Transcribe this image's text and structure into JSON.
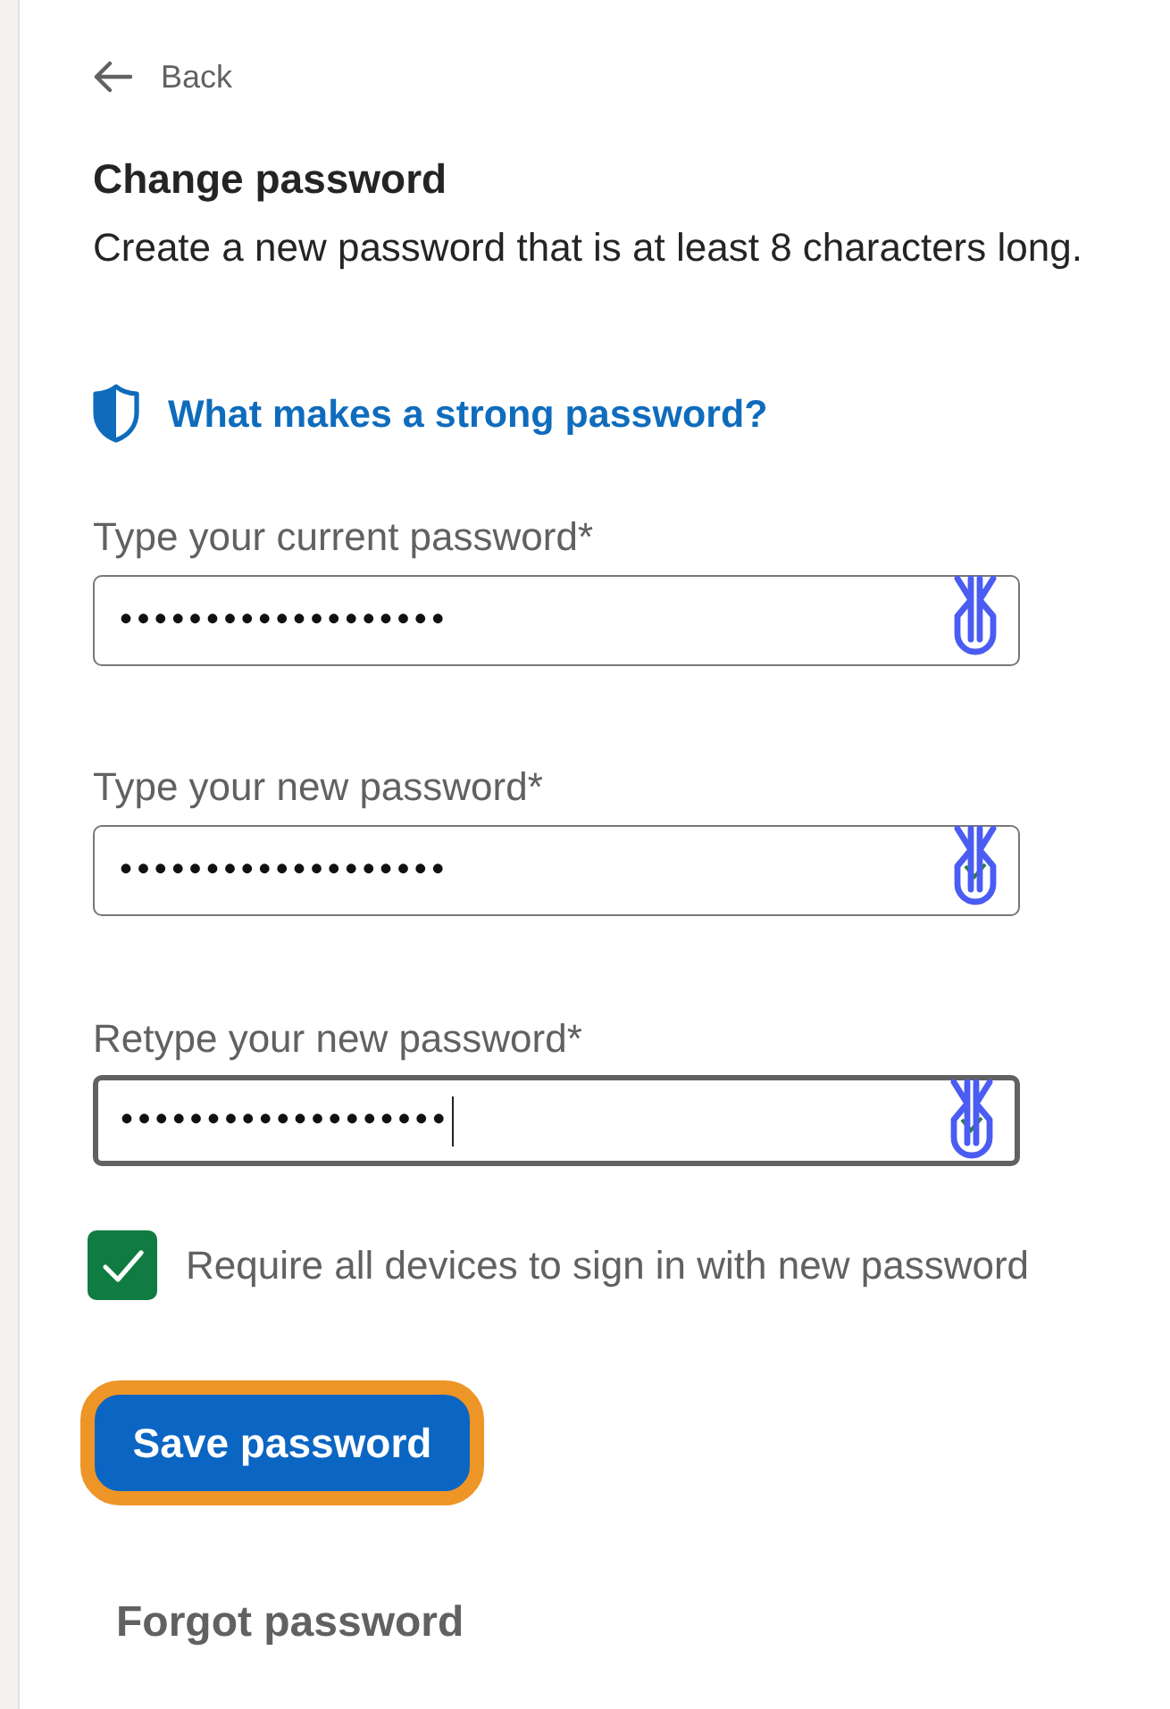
{
  "back": {
    "label": "Back"
  },
  "heading": "Change password",
  "description": "Create a new password that is at least 8 characters long.",
  "help_link": {
    "label": "What makes a strong password?"
  },
  "fields": [
    {
      "label": "Type your current password*",
      "value": "•••••••••••••••••••",
      "focused": false,
      "valid": false
    },
    {
      "label": "Type your new password*",
      "value": "•••••••••••••••••••",
      "focused": false,
      "valid": true
    },
    {
      "label": "Retype your new password*",
      "value": "•••••••••••••••••••",
      "focused": true,
      "valid": true
    }
  ],
  "checkbox": {
    "label": "Require all devices to sign in with new password",
    "checked": true
  },
  "save_button": {
    "label": "Save password",
    "focused": true
  },
  "forgot_link": {
    "label": "Forgot password"
  }
}
